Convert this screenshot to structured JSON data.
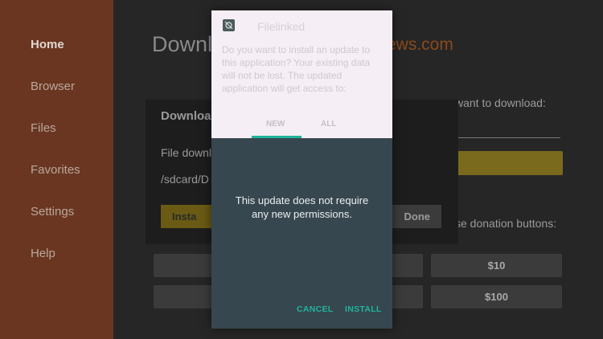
{
  "sidebar": {
    "items": [
      {
        "label": "Home"
      },
      {
        "label": "Browser"
      },
      {
        "label": "Files"
      },
      {
        "label": "Favorites"
      },
      {
        "label": "Settings"
      },
      {
        "label": "Help"
      }
    ]
  },
  "main": {
    "title": "Downl",
    "brand": "ews.com",
    "url_prompt": "want to download:",
    "donation_prompt": "se donation buttons:",
    "donations": [
      "$10",
      "$100"
    ]
  },
  "download_dialog": {
    "title": "Download",
    "line1": "File downl",
    "line2": "/sdcard/D",
    "install_label": "Insta",
    "done_label": "Done"
  },
  "install_dialog": {
    "app_name": "Filelinked",
    "question": "Do you want to install an update to this application? Your existing data will not be lost. The updated application will get access to:",
    "tabs": [
      "NEW",
      "ALL"
    ],
    "message": "This update does not require any new permissions.",
    "cancel_label": "CANCEL",
    "install_label": "INSTALL"
  },
  "colors": {
    "sidebar_bg": "#6a3621",
    "accent_teal": "#1fb49c",
    "dialog_dark": "#37474f"
  }
}
